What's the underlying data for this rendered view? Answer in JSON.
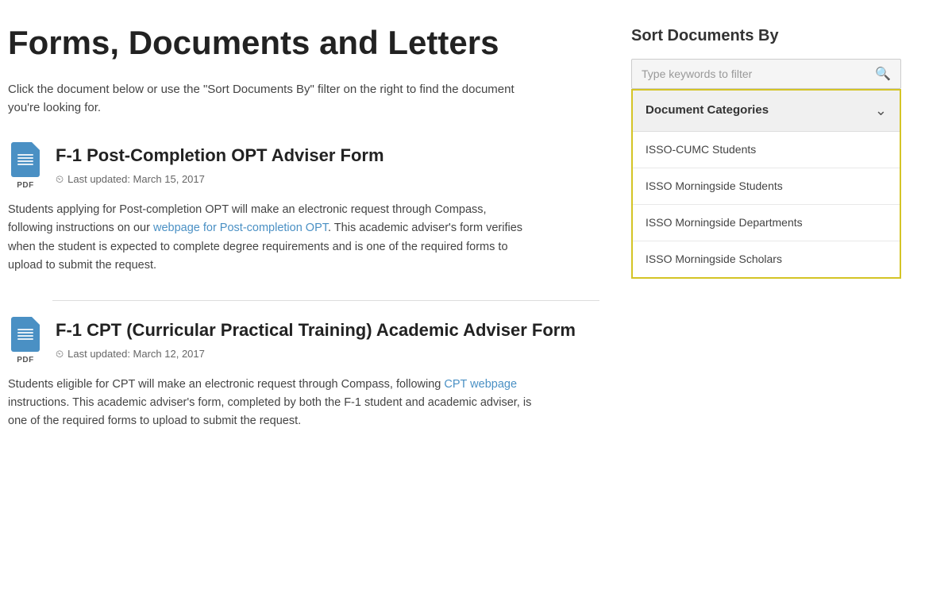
{
  "page": {
    "title": "Forms, Documents and Letters",
    "intro": "Click the document below or use the \"Sort Documents By\" filter on the right to find the document you're looking for."
  },
  "documents": [
    {
      "id": "doc-1",
      "title": "F-1 Post-Completion OPT Adviser Form",
      "updated": "Last updated: March 15, 2017",
      "description_parts": [
        "Students applying for Post-completion OPT will make an electronic request through Compass, following instructions on our ",
        "webpage for Post-completion OPT",
        ". This academic adviser's form verifies when the student is expected to complete degree requirements and is one of the required forms to upload to submit the request."
      ],
      "link_text": "webpage for Post-completion OPT",
      "link_href": "#"
    },
    {
      "id": "doc-2",
      "title": "F-1 CPT (Curricular Practical Training) Academic Adviser Form",
      "updated": "Last updated: March 12, 2017",
      "description_parts": [
        "Students eligible for CPT will make an electronic request through Compass, following ",
        "CPT webpage",
        " instructions. This academic adviser's form, completed by both the F-1 student and academic adviser, is one of the required forms to upload to submit the request."
      ],
      "link_text": "CPT webpage",
      "link_href": "#"
    }
  ],
  "sidebar": {
    "title": "Sort Documents By",
    "search_placeholder": "Type keywords to filter",
    "filter": {
      "header": "Document Categories",
      "items": [
        "ISSO-CUMC Students",
        "ISSO Morningside Students",
        "ISSO Morningside Departments",
        "ISSO Morningside Scholars"
      ]
    }
  }
}
